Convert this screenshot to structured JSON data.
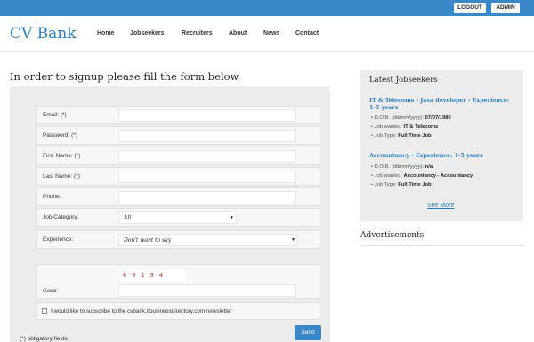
{
  "topbar": {
    "logout_label": "LOGOUT",
    "admin_label": "ADMIN"
  },
  "header": {
    "logo": "CV Bank",
    "nav": [
      "Home",
      "Jobseekers",
      "Recruiters",
      "About",
      "News",
      "Contact"
    ]
  },
  "form": {
    "title": "In order to signup please fill the form below",
    "fields": {
      "email": "Email: (*)",
      "password": "Password: (*)",
      "first_name": "First Name: (*)",
      "last_name": "Last Name: (*)",
      "phone": "Phone:",
      "job_category": "Job Category:",
      "experience": "Experience:"
    },
    "job_category_value": "All",
    "experience_value": "Don't want to say",
    "captcha": "60194",
    "code_label": "Code:",
    "newsletter_label": "I would like to subscribe to the cvbank.itbusinessdirectory.com newsletter",
    "obligatory_note": "(*) obligatory fields",
    "send_label": "Send"
  },
  "sidebar": {
    "title": "Latest Jobseekers",
    "jobs": [
      {
        "title": "IT & Telecoms - Java developer - Experience: 1-5 years",
        "dob_label": "D.O.B. (dd/mm/yyyy):",
        "dob": "07/07/1980",
        "wanted_label": "Job wanted:",
        "wanted": "IT & Telecoms",
        "type_label": "Job Type:",
        "type": "Full Time Job"
      },
      {
        "title": "Accountancy - Experience: 1-5 years",
        "dob_label": "D.O.B. (dd/mm/yyyy):",
        "dob": "n/a",
        "wanted_label": "Job wanted:",
        "wanted": "Accountancy - Accountancy",
        "type_label": "Job Type:",
        "type": "Full Time Job"
      }
    ],
    "see_more": "See More",
    "ads_title": "Advertisements"
  }
}
